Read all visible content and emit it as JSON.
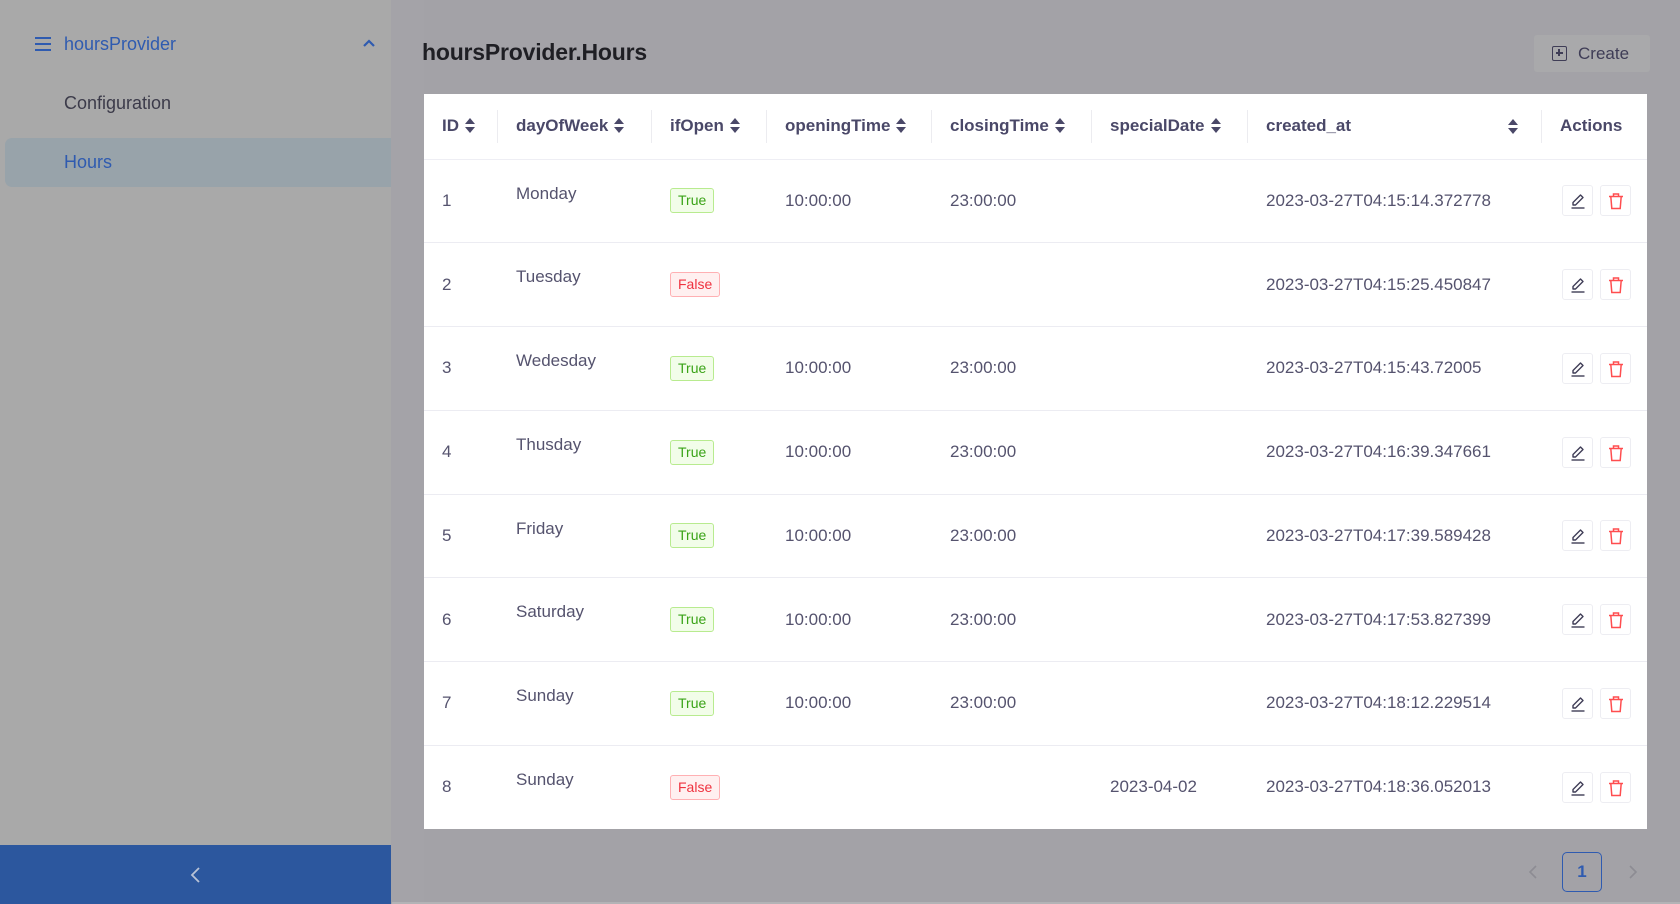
{
  "sidebar": {
    "group_label": "hoursProvider",
    "group_icon": "menu-icon",
    "group_expanded": true,
    "items": [
      {
        "label": "Configuration",
        "active": false
      },
      {
        "label": "Hours",
        "active": true
      }
    ],
    "collapse_icon": "chevron-left-icon"
  },
  "header": {
    "title": "hoursProvider.Hours",
    "create_label": "Create",
    "create_icon": "plus-square-icon"
  },
  "table": {
    "columns": [
      {
        "label": "ID",
        "sortable": true
      },
      {
        "label": "dayOfWeek",
        "sortable": true
      },
      {
        "label": "ifOpen",
        "sortable": true
      },
      {
        "label": "openingTime",
        "sortable": true
      },
      {
        "label": "closingTime",
        "sortable": true
      },
      {
        "label": "specialDate",
        "sortable": true
      },
      {
        "label": "created_at",
        "sortable": true
      },
      {
        "label": "Actions",
        "sortable": false
      }
    ],
    "rows": [
      {
        "id": "1",
        "dayOfWeek": "Monday",
        "ifOpen": "True",
        "openingTime": "10:00:00",
        "closingTime": "23:00:00",
        "specialDate": "",
        "created_at": "2023-03-27T04:15:14.372778"
      },
      {
        "id": "2",
        "dayOfWeek": "Tuesday",
        "ifOpen": "False",
        "openingTime": "",
        "closingTime": "",
        "specialDate": "",
        "created_at": "2023-03-27T04:15:25.450847"
      },
      {
        "id": "3",
        "dayOfWeek": "Wedesday",
        "ifOpen": "True",
        "openingTime": "10:00:00",
        "closingTime": "23:00:00",
        "specialDate": "",
        "created_at": "2023-03-27T04:15:43.72005"
      },
      {
        "id": "4",
        "dayOfWeek": "Thusday",
        "ifOpen": "True",
        "openingTime": "10:00:00",
        "closingTime": "23:00:00",
        "specialDate": "",
        "created_at": "2023-03-27T04:16:39.347661"
      },
      {
        "id": "5",
        "dayOfWeek": "Friday",
        "ifOpen": "True",
        "openingTime": "10:00:00",
        "closingTime": "23:00:00",
        "specialDate": "",
        "created_at": "2023-03-27T04:17:39.589428"
      },
      {
        "id": "6",
        "dayOfWeek": "Saturday",
        "ifOpen": "True",
        "openingTime": "10:00:00",
        "closingTime": "23:00:00",
        "specialDate": "",
        "created_at": "2023-03-27T04:17:53.827399"
      },
      {
        "id": "7",
        "dayOfWeek": "Sunday",
        "ifOpen": "True",
        "openingTime": "10:00:00",
        "closingTime": "23:00:00",
        "specialDate": "",
        "created_at": "2023-03-27T04:18:12.229514"
      },
      {
        "id": "8",
        "dayOfWeek": "Sunday",
        "ifOpen": "False",
        "openingTime": "",
        "closingTime": "",
        "specialDate": "2023-04-02",
        "created_at": "2023-03-27T04:18:36.052013"
      }
    ],
    "row_action_icons": [
      "edit-icon",
      "delete-icon"
    ]
  },
  "pagination": {
    "current_page": "1",
    "prev_icon": "chevron-left-icon",
    "next_icon": "chevron-right-icon"
  },
  "colors": {
    "accent": "#2f5bb0",
    "collapse_bar": "#2c579e",
    "true_badge": "#3aa317",
    "false_badge": "#ef3340",
    "delete_icon": "#ff4d4f"
  }
}
